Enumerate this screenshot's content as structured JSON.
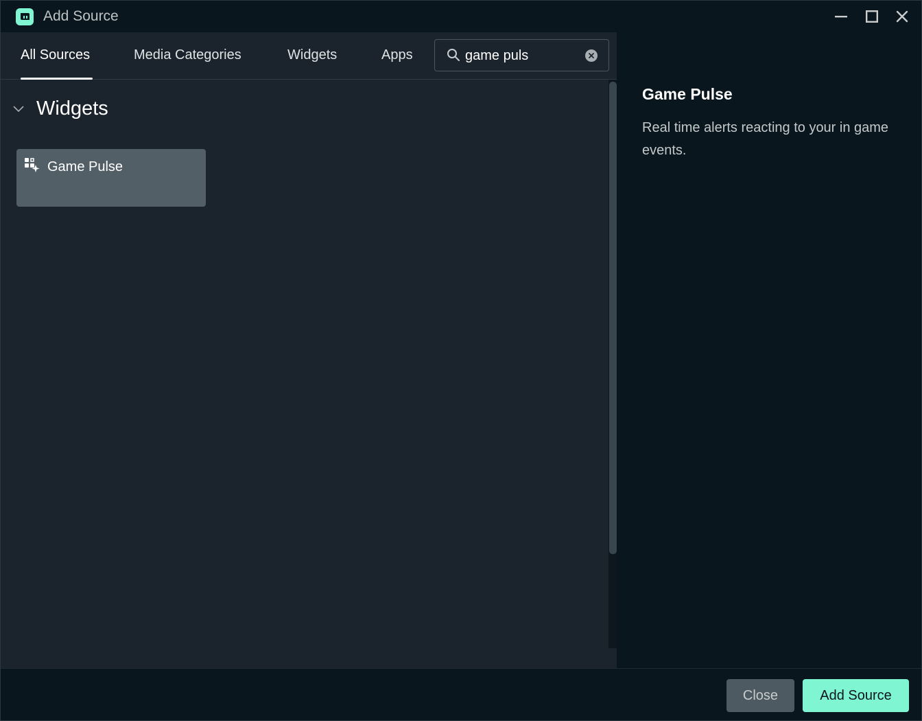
{
  "window": {
    "title": "Add Source"
  },
  "tabs": [
    {
      "label": "All Sources",
      "active": true
    },
    {
      "label": "Media Categories",
      "active": false
    },
    {
      "label": "Widgets",
      "active": false
    },
    {
      "label": "Apps",
      "active": false
    }
  ],
  "search": {
    "value": "game puls"
  },
  "section": {
    "title": "Widgets",
    "expanded": true
  },
  "results": [
    {
      "label": "Game Pulse",
      "icon": "widget-sparkle-icon"
    }
  ],
  "detail": {
    "title": "Game Pulse",
    "description": "Real time alerts reacting to your in game events."
  },
  "footer": {
    "close_label": "Close",
    "add_label": "Add Source"
  },
  "colors": {
    "accent": "#80f5d2",
    "panel": "#1b242d",
    "background": "#09161d",
    "card": "#535f66"
  }
}
